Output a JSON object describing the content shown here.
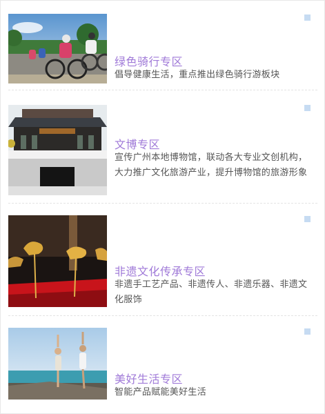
{
  "items": [
    {
      "title": "绿色骑行专区",
      "description": "倡导健康生活，重点推出绿色骑行游板块",
      "image_icon": "cycling-photo"
    },
    {
      "title": "文博专区",
      "description": "宣传广州本地博物馆，联动各大专业文创机构，大力推广文化旅游产业，提升博物馆的旅游形象",
      "image_icon": "museum-photo"
    },
    {
      "title": "非遗文化传承专区",
      "description": "非遗手工艺产品、非遗传人、非遗乐器、非遗文化服饰",
      "image_icon": "heritage-craft-photo"
    },
    {
      "title": "美好生活专区",
      "description": "智能产品赋能美好生活",
      "image_icon": "yoga-photo"
    }
  ],
  "colors": {
    "title": "#a07ad8",
    "description": "#555555",
    "marker": "#c6dbf2",
    "divider": "#e3e3e3"
  }
}
